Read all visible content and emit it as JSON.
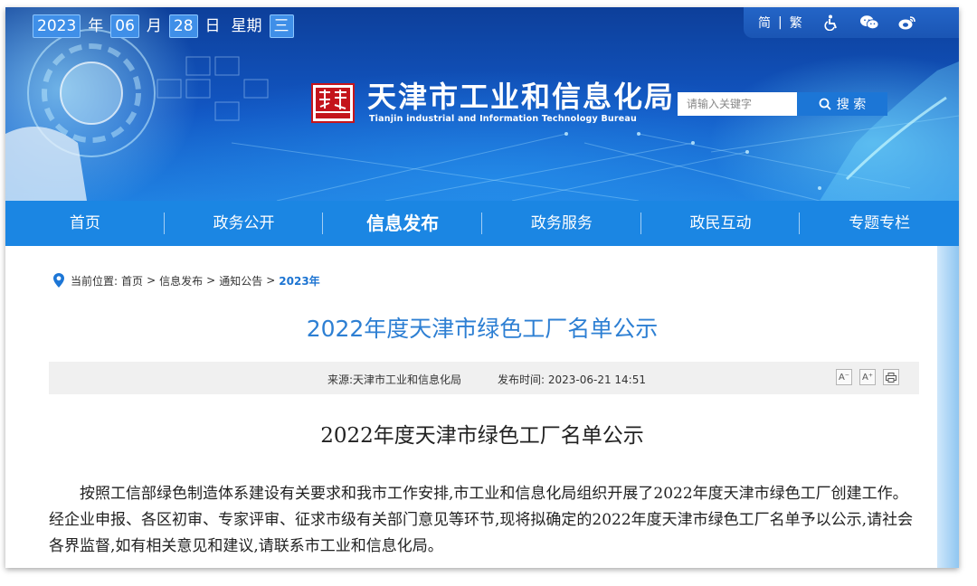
{
  "header": {
    "date": {
      "year": "2023",
      "year_label": "年",
      "month": "06",
      "month_label": "月",
      "day": "28",
      "day_label": "日",
      "weekday_label": "星期",
      "weekday": "三"
    },
    "tools": {
      "simplified": "简",
      "divider": "|",
      "traditional": "繁",
      "icons": [
        "accessibility-icon",
        "wechat-icon",
        "weibo-icon"
      ]
    },
    "logo_icon": "tianjin-seal-logo",
    "site_title": "天津市工业和信息化局",
    "site_subtitle": "Tianjin industrial and Information Technology Bureau",
    "search": {
      "placeholder": "请输入关键字",
      "button_label": "搜 索"
    }
  },
  "nav": {
    "items": [
      {
        "label": "首页",
        "active": false
      },
      {
        "label": "政务公开",
        "active": false
      },
      {
        "label": "信息发布",
        "active": true
      },
      {
        "label": "政务服务",
        "active": false
      },
      {
        "label": "政民互动",
        "active": false
      },
      {
        "label": "专题专栏",
        "active": false
      }
    ]
  },
  "breadcrumb": {
    "prefix": "当前位置:",
    "items": [
      "首页",
      "信息发布",
      "通知公告"
    ],
    "separator": ">",
    "current": "2023年"
  },
  "page_title": "2022年度天津市绿色工厂名单公示",
  "meta": {
    "source": "来源:天津市工业和信息化局",
    "published": "发布时间: 2023-06-21 14:51",
    "tools": {
      "font_smaller": "A⁻",
      "font_larger": "A⁺",
      "print_icon": "print-icon"
    }
  },
  "article": {
    "title": "2022年度天津市绿色工厂名单公示",
    "paragraph": "按照工信部绿色制造体系建设有关要求和我市工作安排,市工业和信息化局组织开展了2022年度天津市绿色工厂创建工作。经企业申报、各区初审、专家评审、征求市级有关部门意见等环节,现将拟确定的2022年度天津市绿色工厂名单予以公示,请社会各界监督,如有相关意见和建议,请联系市工业和信息化局。"
  },
  "colors": {
    "nav_blue": "#1b86e3",
    "title_blue": "#2d7fd3",
    "banner_dark": "#0d3f9a",
    "seal_red": "#c4151c"
  }
}
